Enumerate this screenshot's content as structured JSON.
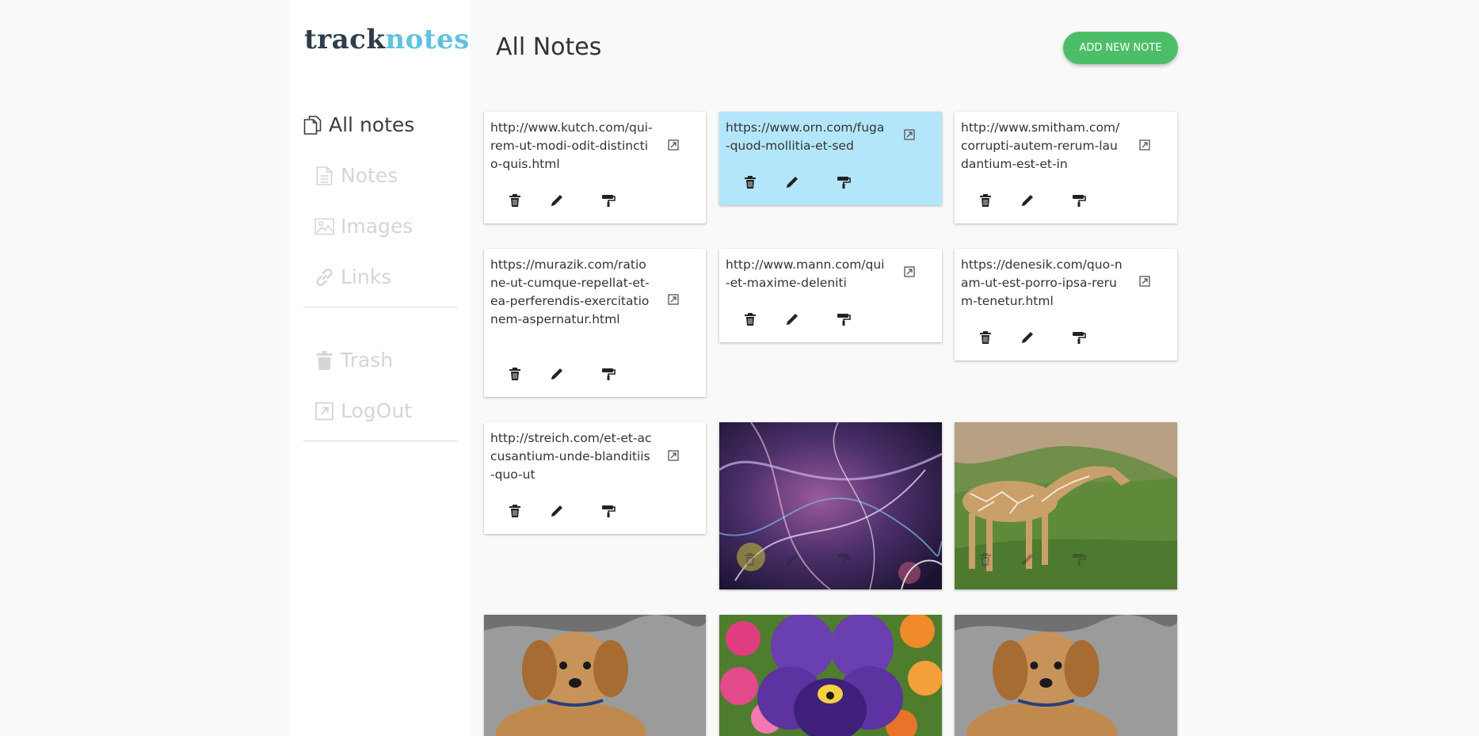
{
  "app": {
    "logo_part1": "track",
    "logo_part2": "notes",
    "brand_dark": "#2f3d4a",
    "brand_light": "#5ec3e0",
    "accent": "#4dbe68"
  },
  "sidebar": {
    "items": [
      {
        "label": "All notes",
        "icon": "copy-icon",
        "active": true
      },
      {
        "label": "Notes",
        "icon": "document-icon",
        "active": false
      },
      {
        "label": "Images",
        "icon": "image-icon",
        "active": false
      },
      {
        "label": "Links",
        "icon": "link-icon",
        "active": false
      },
      {
        "label": "Trash",
        "icon": "trash-icon",
        "active": false
      },
      {
        "label": "LogOut",
        "icon": "logout-icon",
        "active": false
      }
    ]
  },
  "header": {
    "title": "All Notes",
    "add_button_label": "ADD NEW NOTE"
  },
  "notes": [
    {
      "type": "link",
      "url": "http://www.kutch.com/qui-rem-ut-modi-odit-distinctio-quis.html"
    },
    {
      "type": "link",
      "url": "https://www.orn.com/fuga-quod-mollitia-et-sed",
      "color": "#b4e6fb"
    },
    {
      "type": "link",
      "url": "http://www.smitham.com/corrupti-autem-rerum-laudantium-est-et-in"
    },
    {
      "type": "link",
      "url": "https://murazik.com/ratione-ut-cumque-repellat-et-ea-perferendis-exercitationem-aspernatur.html"
    },
    {
      "type": "link",
      "url": "http://www.mann.com/qui-et-maxime-deleniti"
    },
    {
      "type": "link",
      "url": "https://denesik.com/quo-nam-ut-est-porro-ipsa-rerum-tenetur.html"
    },
    {
      "type": "link",
      "url": "http://streich.com/et-et-accusantium-unde-blanditiis-quo-ut"
    },
    {
      "type": "image",
      "subject": "abstract-art"
    },
    {
      "type": "image",
      "subject": "giraffe"
    },
    {
      "type": "image",
      "subject": "puppy"
    },
    {
      "type": "image",
      "subject": "pansy-flower"
    },
    {
      "type": "image",
      "subject": "puppy"
    }
  ]
}
